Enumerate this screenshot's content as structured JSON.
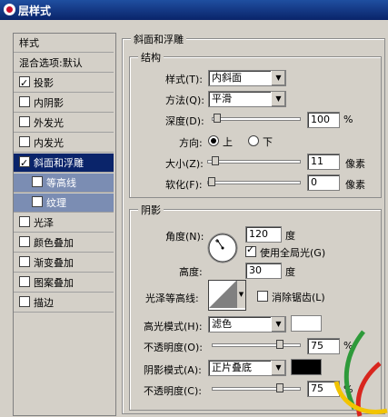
{
  "window": {
    "title": "层样式"
  },
  "sidebar": {
    "header": "样式",
    "blend_default": "混合选项:默认",
    "items": [
      {
        "label": "投影",
        "checked": true
      },
      {
        "label": "内阴影",
        "checked": false
      },
      {
        "label": "外发光",
        "checked": false
      },
      {
        "label": "内发光",
        "checked": false
      },
      {
        "label": "斜面和浮雕",
        "checked": true
      },
      {
        "label": "等高线",
        "checked": false
      },
      {
        "label": "纹理",
        "checked": false
      },
      {
        "label": "光泽",
        "checked": false
      },
      {
        "label": "颜色叠加",
        "checked": false
      },
      {
        "label": "渐变叠加",
        "checked": false
      },
      {
        "label": "图案叠加",
        "checked": false
      },
      {
        "label": "描边",
        "checked": false
      }
    ]
  },
  "bevel": {
    "title": "斜面和浮雕",
    "structure": {
      "title": "结构",
      "style_label": "样式(T):",
      "style_value": "内斜面",
      "method_label": "方法(Q):",
      "method_value": "平滑",
      "depth_label": "深度(D):",
      "depth_value": "100",
      "percent": "%",
      "depth_fraction": 0.05,
      "direction_label": "方向:",
      "dir_up": "上",
      "dir_down": "下",
      "size_label": "大小(Z):",
      "size_value": "11",
      "size_fraction": 0.05,
      "soften_label": "软化(F):",
      "soften_value": "0",
      "soften_fraction": 0.0,
      "px": "像素"
    },
    "shading": {
      "title": "阴影",
      "angle_label": "角度(N):",
      "angle_value": "120",
      "degree": "度",
      "global_light": "使用全局光(G)",
      "altitude_label": "高度:",
      "altitude_value": "30",
      "gloss_label": "光泽等高线:",
      "anti_alias": "消除锯齿(L)",
      "highlight_mode_label": "高光模式(H):",
      "highlight_mode_value": "滤色",
      "highlight_color": "#ffffff",
      "opacity_label": "不透明度(O):",
      "opacity_value": "75",
      "opacity_fraction": 0.75,
      "shadow_mode_label": "阴影模式(A):",
      "shadow_mode_value": "正片叠底",
      "shadow_color": "#000000",
      "opacity2_label": "不透明度(C):",
      "opacity2_value": "75",
      "opacity2_fraction": 0.75
    }
  }
}
